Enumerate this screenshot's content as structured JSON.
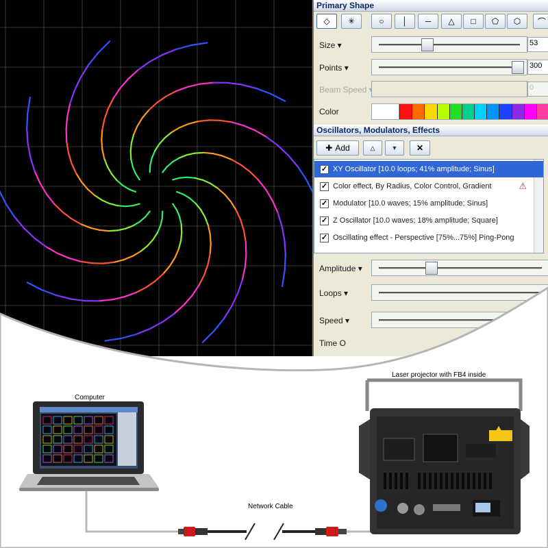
{
  "panel": {
    "primary_shape_title": "Primary Shape",
    "shape_buttons": [
      "diamond-icon",
      "star-icon",
      "circle-icon",
      "vertical-line-icon",
      "horizontal-line-icon",
      "triangle-icon",
      "square-icon",
      "pentagon-icon",
      "hexagon-icon",
      "curve-icon"
    ],
    "size_label": "Size",
    "size_value": "53",
    "points_label": "Points",
    "points_value": "300",
    "beam_speed_label": "Beam Speed",
    "beam_speed_value": "0",
    "color_label": "Color",
    "colors": [
      "#ff1010",
      "#ff6a00",
      "#ffd800",
      "#b6ff00",
      "#22dd22",
      "#00d08a",
      "#00d0ff",
      "#0094ff",
      "#2040ff",
      "#8a2be2",
      "#ff00ff",
      "#ff3f9f"
    ],
    "osc_title": "Oscillators, Modulators, Effects",
    "add_label": "Add",
    "osc_items": [
      {
        "label": "XY Oscillator [10.0 loops; 41% amplitude; Sinus]",
        "checked": true,
        "selected": true
      },
      {
        "label": "Color effect, By Radius, Color Control, Gradient",
        "checked": true,
        "selected": false
      },
      {
        "label": "Modulator [10.0 waves; 15% amplitude; Sinus]",
        "checked": true,
        "selected": false
      },
      {
        "label": "Z Oscillator [10.0 waves; 18% amplitude; Square]",
        "checked": true,
        "selected": false
      },
      {
        "label": "Oscillating effect - Perspective [75%...75%] Ping-Pong",
        "checked": true,
        "selected": false
      }
    ],
    "amplitude_label": "Amplitude",
    "loops_label": "Loops",
    "speed_label": "Speed",
    "time_label": "Time O"
  },
  "diagram": {
    "computer_label": "Computer",
    "projector_label": "Laser projector with FB4 inside",
    "cable_label": "Network Cable"
  }
}
